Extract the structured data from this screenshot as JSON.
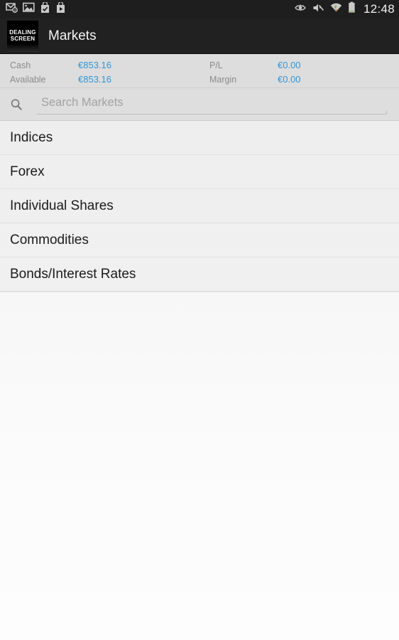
{
  "statusbar": {
    "time": "12:48",
    "left_icons": [
      {
        "name": "email-icon",
        "label": "Email"
      },
      {
        "name": "photo-icon",
        "label": "Gallery"
      },
      {
        "name": "app-checked-icon",
        "label": "Play Store update complete"
      },
      {
        "name": "play-store-icon",
        "label": "Play Store"
      }
    ],
    "right_icons": [
      {
        "name": "eye-icon",
        "label": "Smart stay"
      },
      {
        "name": "mute-icon",
        "label": "Sound muted"
      },
      {
        "name": "wifi-icon",
        "label": "Wi-Fi connected"
      },
      {
        "name": "battery-icon",
        "label": "Battery"
      }
    ]
  },
  "actionbar": {
    "logo_line1": "DEALING",
    "logo_line2": "SCREEN",
    "title": "Markets"
  },
  "account": {
    "left": [
      {
        "label": "Cash",
        "value": "€853.16"
      },
      {
        "label": "Available",
        "value": "€853.16"
      }
    ],
    "right": [
      {
        "label": "P/L",
        "value": "€0.00"
      },
      {
        "label": "Margin",
        "value": "€0.00"
      }
    ]
  },
  "search": {
    "icon": "search-icon",
    "value": "",
    "placeholder": "Search Markets"
  },
  "markets": {
    "items": [
      {
        "label": "Indices"
      },
      {
        "label": "Forex"
      },
      {
        "label": "Individual Shares"
      },
      {
        "label": "Commodities"
      },
      {
        "label": "Bonds/Interest Rates"
      }
    ]
  },
  "colors": {
    "accent_value": "#2f96d8",
    "actionbar_bg": "#212121",
    "statusbar_bg": "#1e1e1e",
    "account_bg": "#dddddd",
    "list_bg": "#eeeeee",
    "label_gray": "#8b8b8b"
  }
}
